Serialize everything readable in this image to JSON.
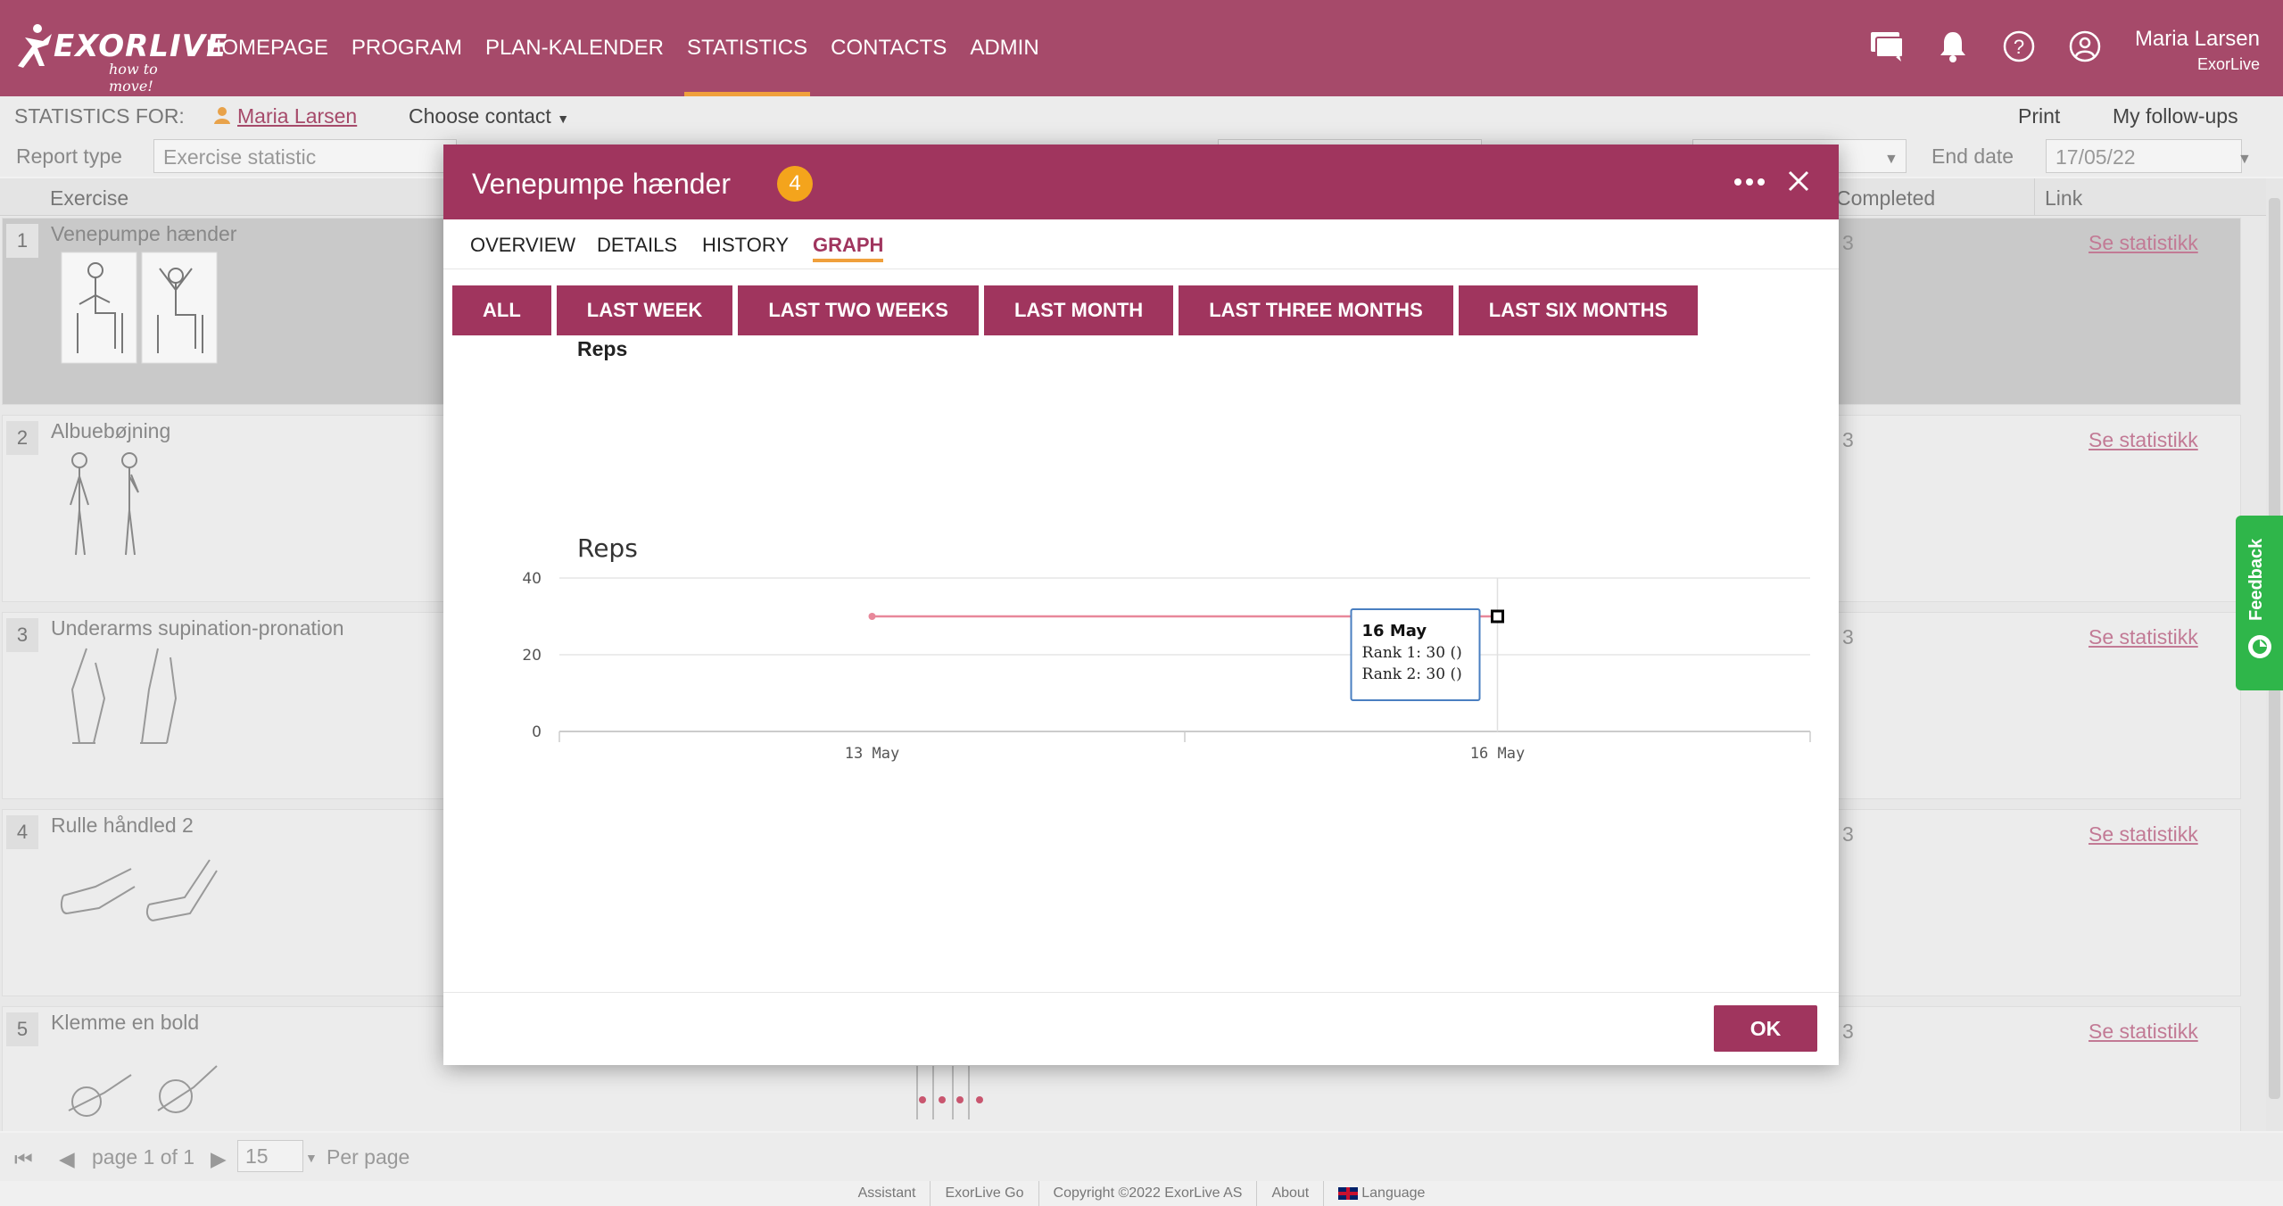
{
  "app": {
    "logo_text": "EXORLIVE",
    "logo_tagline": "how to move!",
    "nav": [
      {
        "label": "HOMEPAGE"
      },
      {
        "label": "PROGRAM"
      },
      {
        "label": "PLAN-KALENDER"
      },
      {
        "label": "STATISTICS"
      },
      {
        "label": "CONTACTS"
      },
      {
        "label": "ADMIN"
      }
    ],
    "active_nav": "STATISTICS",
    "user_name": "Maria Larsen",
    "user_org": "ExorLive"
  },
  "subbar": {
    "label": "STATISTICS FOR:",
    "contact_name": "Maria Larsen",
    "choose_contact": "Choose contact",
    "print": "Print",
    "follow_ups": "My follow-ups"
  },
  "report": {
    "type_label": "Report type",
    "type_value": "Exercise statistic",
    "end_date_label": "End date",
    "end_date_value": "17/05/22"
  },
  "grid": {
    "columns": {
      "exercise": "Exercise",
      "completed": "Completed",
      "link": "Link"
    },
    "rows": [
      {
        "num": "1",
        "name": "Venepumpe hænder",
        "completed": "3",
        "link": "Se statistikk"
      },
      {
        "num": "2",
        "name": "Albuebøjning",
        "completed": "3",
        "link": "Se statistikk"
      },
      {
        "num": "3",
        "name": "Underarms supination-pronation",
        "completed": "3",
        "link": "Se statistikk"
      },
      {
        "num": "4",
        "name": "Rulle håndled 2",
        "completed": "3",
        "link": "Se statistikk"
      },
      {
        "num": "5",
        "name": "Klemme en bold",
        "completed": "3",
        "link": "Se statistikk"
      }
    ]
  },
  "pager": {
    "text": "page 1 of 1",
    "page_size": "15",
    "per_page": "Per page"
  },
  "footer": {
    "items": [
      "Assistant",
      "ExorLive Go",
      "Copyright ©2022 ExorLive AS",
      "About",
      "Language"
    ]
  },
  "dialog": {
    "title": "Venepumpe hænder",
    "badge": "4",
    "tabs": [
      "OVERVIEW",
      "DETAILS",
      "HISTORY",
      "GRAPH"
    ],
    "active_tab": "GRAPH",
    "ranges": [
      "ALL",
      "LAST WEEK",
      "LAST TWO WEEKS",
      "LAST MONTH",
      "LAST THREE MONTHS",
      "LAST SIX MONTHS"
    ],
    "graph_subtitle": "Reps",
    "ok": "OK"
  },
  "chart_data": {
    "type": "line",
    "title": "Reps",
    "x": [
      "13 May",
      "16 May"
    ],
    "series": [
      {
        "values": [
          30,
          30
        ],
        "color": "#e8889a"
      }
    ],
    "ylim": [
      0,
      40
    ],
    "yticks": [
      0,
      20,
      40
    ],
    "grid": true,
    "tooltip": {
      "title": "16 May",
      "lines": [
        "Rank 1: 30 ()",
        "Rank 2: 30 ()"
      ]
    }
  },
  "feedback": {
    "label": "Feedback"
  },
  "colors": {
    "brand": "#a64a6a",
    "dialog_brand": "#a0355e",
    "accent": "#f0a03c",
    "badge": "#f4a41c",
    "feedback": "#2fb64a"
  }
}
